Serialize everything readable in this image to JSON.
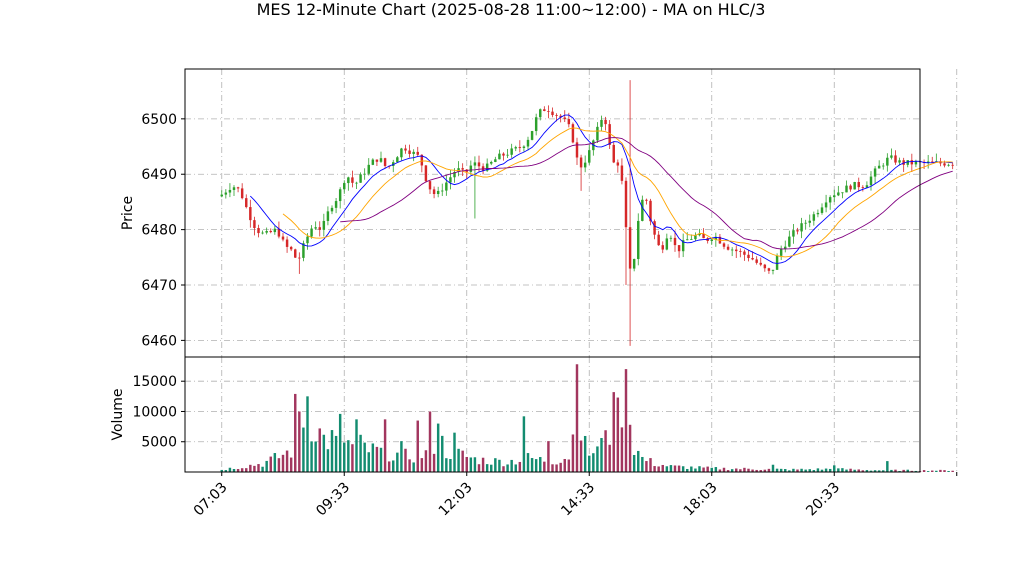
{
  "chart_data": {
    "type": "candlestick",
    "title": "MES 12-Minute Chart (2025-08-28 11:00~12:00) - MA on HLC/3",
    "colors": {
      "up": "#2ca02c",
      "down": "#d62728",
      "vol_up": "#138c70",
      "vol_down": "#a2365e",
      "ma_fast": "#0000ff",
      "ma_mid": "#ffa500",
      "ma_slow": "#800080",
      "grid": "#b0b0b0"
    },
    "price_panel": {
      "ylabel": "Price",
      "ylim": [
        6457,
        6509
      ],
      "yticks": [
        6460,
        6470,
        6480,
        6490,
        6500
      ],
      "grid": true
    },
    "volume_panel": {
      "ylabel": "Volume",
      "ylim": [
        0,
        19000
      ],
      "yticks": [
        5000,
        10000,
        15000
      ],
      "grid": true
    },
    "x_axis": {
      "xlim": [
        -9,
        171
      ],
      "tick_labels": [
        "07:03",
        "09:33",
        "12:03",
        "14:33",
        "18:03",
        "20:33",
        ""
      ],
      "tick_positions": [
        0,
        30,
        60,
        90,
        120,
        150,
        180
      ]
    },
    "bar_count": 180,
    "price_anchors": [
      [
        0,
        6486
      ],
      [
        3,
        6488
      ],
      [
        5,
        6487
      ],
      [
        7,
        6483
      ],
      [
        9,
        6480
      ],
      [
        11,
        6479
      ],
      [
        14,
        6480
      ],
      [
        16,
        6477
      ],
      [
        18,
        6476
      ],
      [
        19,
        6474
      ],
      [
        21,
        6478
      ],
      [
        23,
        6481
      ],
      [
        25,
        6480
      ],
      [
        27,
        6484
      ],
      [
        29,
        6486
      ],
      [
        31,
        6490
      ],
      [
        33,
        6488
      ],
      [
        35,
        6490
      ],
      [
        37,
        6492
      ],
      [
        39,
        6493
      ],
      [
        41,
        6491
      ],
      [
        43,
        6493
      ],
      [
        45,
        6495
      ],
      [
        47,
        6494
      ],
      [
        49,
        6493
      ],
      [
        51,
        6488
      ],
      [
        53,
        6486
      ],
      [
        55,
        6488
      ],
      [
        58,
        6491
      ],
      [
        60,
        6490
      ],
      [
        62,
        6492
      ],
      [
        65,
        6491
      ],
      [
        68,
        6493
      ],
      [
        71,
        6494
      ],
      [
        74,
        6495
      ],
      [
        76,
        6497
      ],
      [
        78,
        6501
      ],
      [
        80,
        6502
      ],
      [
        82,
        6501
      ],
      [
        84,
        6500
      ],
      [
        86,
        6498
      ],
      [
        88,
        6491
      ],
      [
        90,
        6493
      ],
      [
        92,
        6497
      ],
      [
        94,
        6501
      ],
      [
        95,
        6498
      ],
      [
        96,
        6492
      ],
      [
        98,
        6492
      ],
      [
        99,
        6485
      ],
      [
        100,
        6475
      ],
      [
        101,
        6470
      ],
      [
        102,
        6480
      ],
      [
        104,
        6487
      ],
      [
        106,
        6480
      ],
      [
        108,
        6476
      ],
      [
        110,
        6480
      ],
      [
        112,
        6476
      ],
      [
        114,
        6478
      ],
      [
        117,
        6479
      ],
      [
        119,
        6478
      ],
      [
        121,
        6479
      ],
      [
        124,
        6477
      ],
      [
        127,
        6476
      ],
      [
        130,
        6475
      ],
      [
        133,
        6473
      ],
      [
        135,
        6472
      ],
      [
        137,
        6476
      ],
      [
        140,
        6479
      ],
      [
        143,
        6481
      ],
      [
        146,
        6483
      ],
      [
        149,
        6486
      ],
      [
        152,
        6487
      ],
      [
        155,
        6488
      ],
      [
        158,
        6488
      ],
      [
        161,
        6491
      ],
      [
        164,
        6493
      ],
      [
        167,
        6492
      ],
      [
        170,
        6492
      ],
      [
        172,
        6492
      ]
    ],
    "volume_anchors": [
      [
        0,
        400
      ],
      [
        5,
        900
      ],
      [
        10,
        1400
      ],
      [
        14,
        2500
      ],
      [
        17,
        3500
      ],
      [
        18,
        6800
      ],
      [
        19,
        11500
      ],
      [
        20,
        9500
      ],
      [
        21,
        7800
      ],
      [
        22,
        8300
      ],
      [
        23,
        7600
      ],
      [
        24,
        6800
      ],
      [
        25,
        5400
      ],
      [
        26,
        5200
      ],
      [
        27,
        5500
      ],
      [
        28,
        5000
      ],
      [
        29,
        6600
      ],
      [
        30,
        5600
      ],
      [
        31,
        4600
      ],
      [
        32,
        4300
      ],
      [
        34,
        4500
      ],
      [
        36,
        3600
      ],
      [
        40,
        3300
      ],
      [
        44,
        2700
      ],
      [
        48,
        2600
      ],
      [
        51,
        3400
      ],
      [
        53,
        6000
      ],
      [
        55,
        3400
      ],
      [
        58,
        3000
      ],
      [
        62,
        2100
      ],
      [
        66,
        1800
      ],
      [
        70,
        1700
      ],
      [
        73,
        2000
      ],
      [
        75,
        2300
      ],
      [
        78,
        2000
      ],
      [
        82,
        1900
      ],
      [
        85,
        2600
      ],
      [
        87,
        4000
      ],
      [
        88,
        5400
      ],
      [
        90,
        3100
      ],
      [
        92,
        3700
      ],
      [
        94,
        4700
      ],
      [
        96,
        8500
      ],
      [
        97,
        4800
      ],
      [
        99,
        6600
      ],
      [
        100,
        6500
      ],
      [
        101,
        4300
      ],
      [
        103,
        2200
      ],
      [
        106,
        1400
      ],
      [
        110,
        900
      ],
      [
        120,
        600
      ],
      [
        140,
        400
      ],
      [
        150,
        500
      ],
      [
        160,
        300
      ],
      [
        172,
        250
      ]
    ],
    "volume_spikes": [
      [
        18,
        12900
      ],
      [
        19,
        10000
      ],
      [
        21,
        12500
      ],
      [
        24,
        7200
      ],
      [
        29,
        9600
      ],
      [
        33,
        8700
      ],
      [
        40,
        8700
      ],
      [
        44,
        5100
      ],
      [
        48,
        8500
      ],
      [
        51,
        10000
      ],
      [
        53,
        8000
      ],
      [
        57,
        6500
      ],
      [
        74,
        9200
      ],
      [
        80,
        5100
      ],
      [
        86,
        6200
      ],
      [
        87,
        17800
      ],
      [
        88,
        5200
      ],
      [
        94,
        6900
      ],
      [
        96,
        13200
      ],
      [
        97,
        12300
      ],
      [
        99,
        17000
      ],
      [
        100,
        7800
      ],
      [
        135,
        1200
      ],
      [
        150,
        1100
      ],
      [
        163,
        1800
      ]
    ]
  }
}
